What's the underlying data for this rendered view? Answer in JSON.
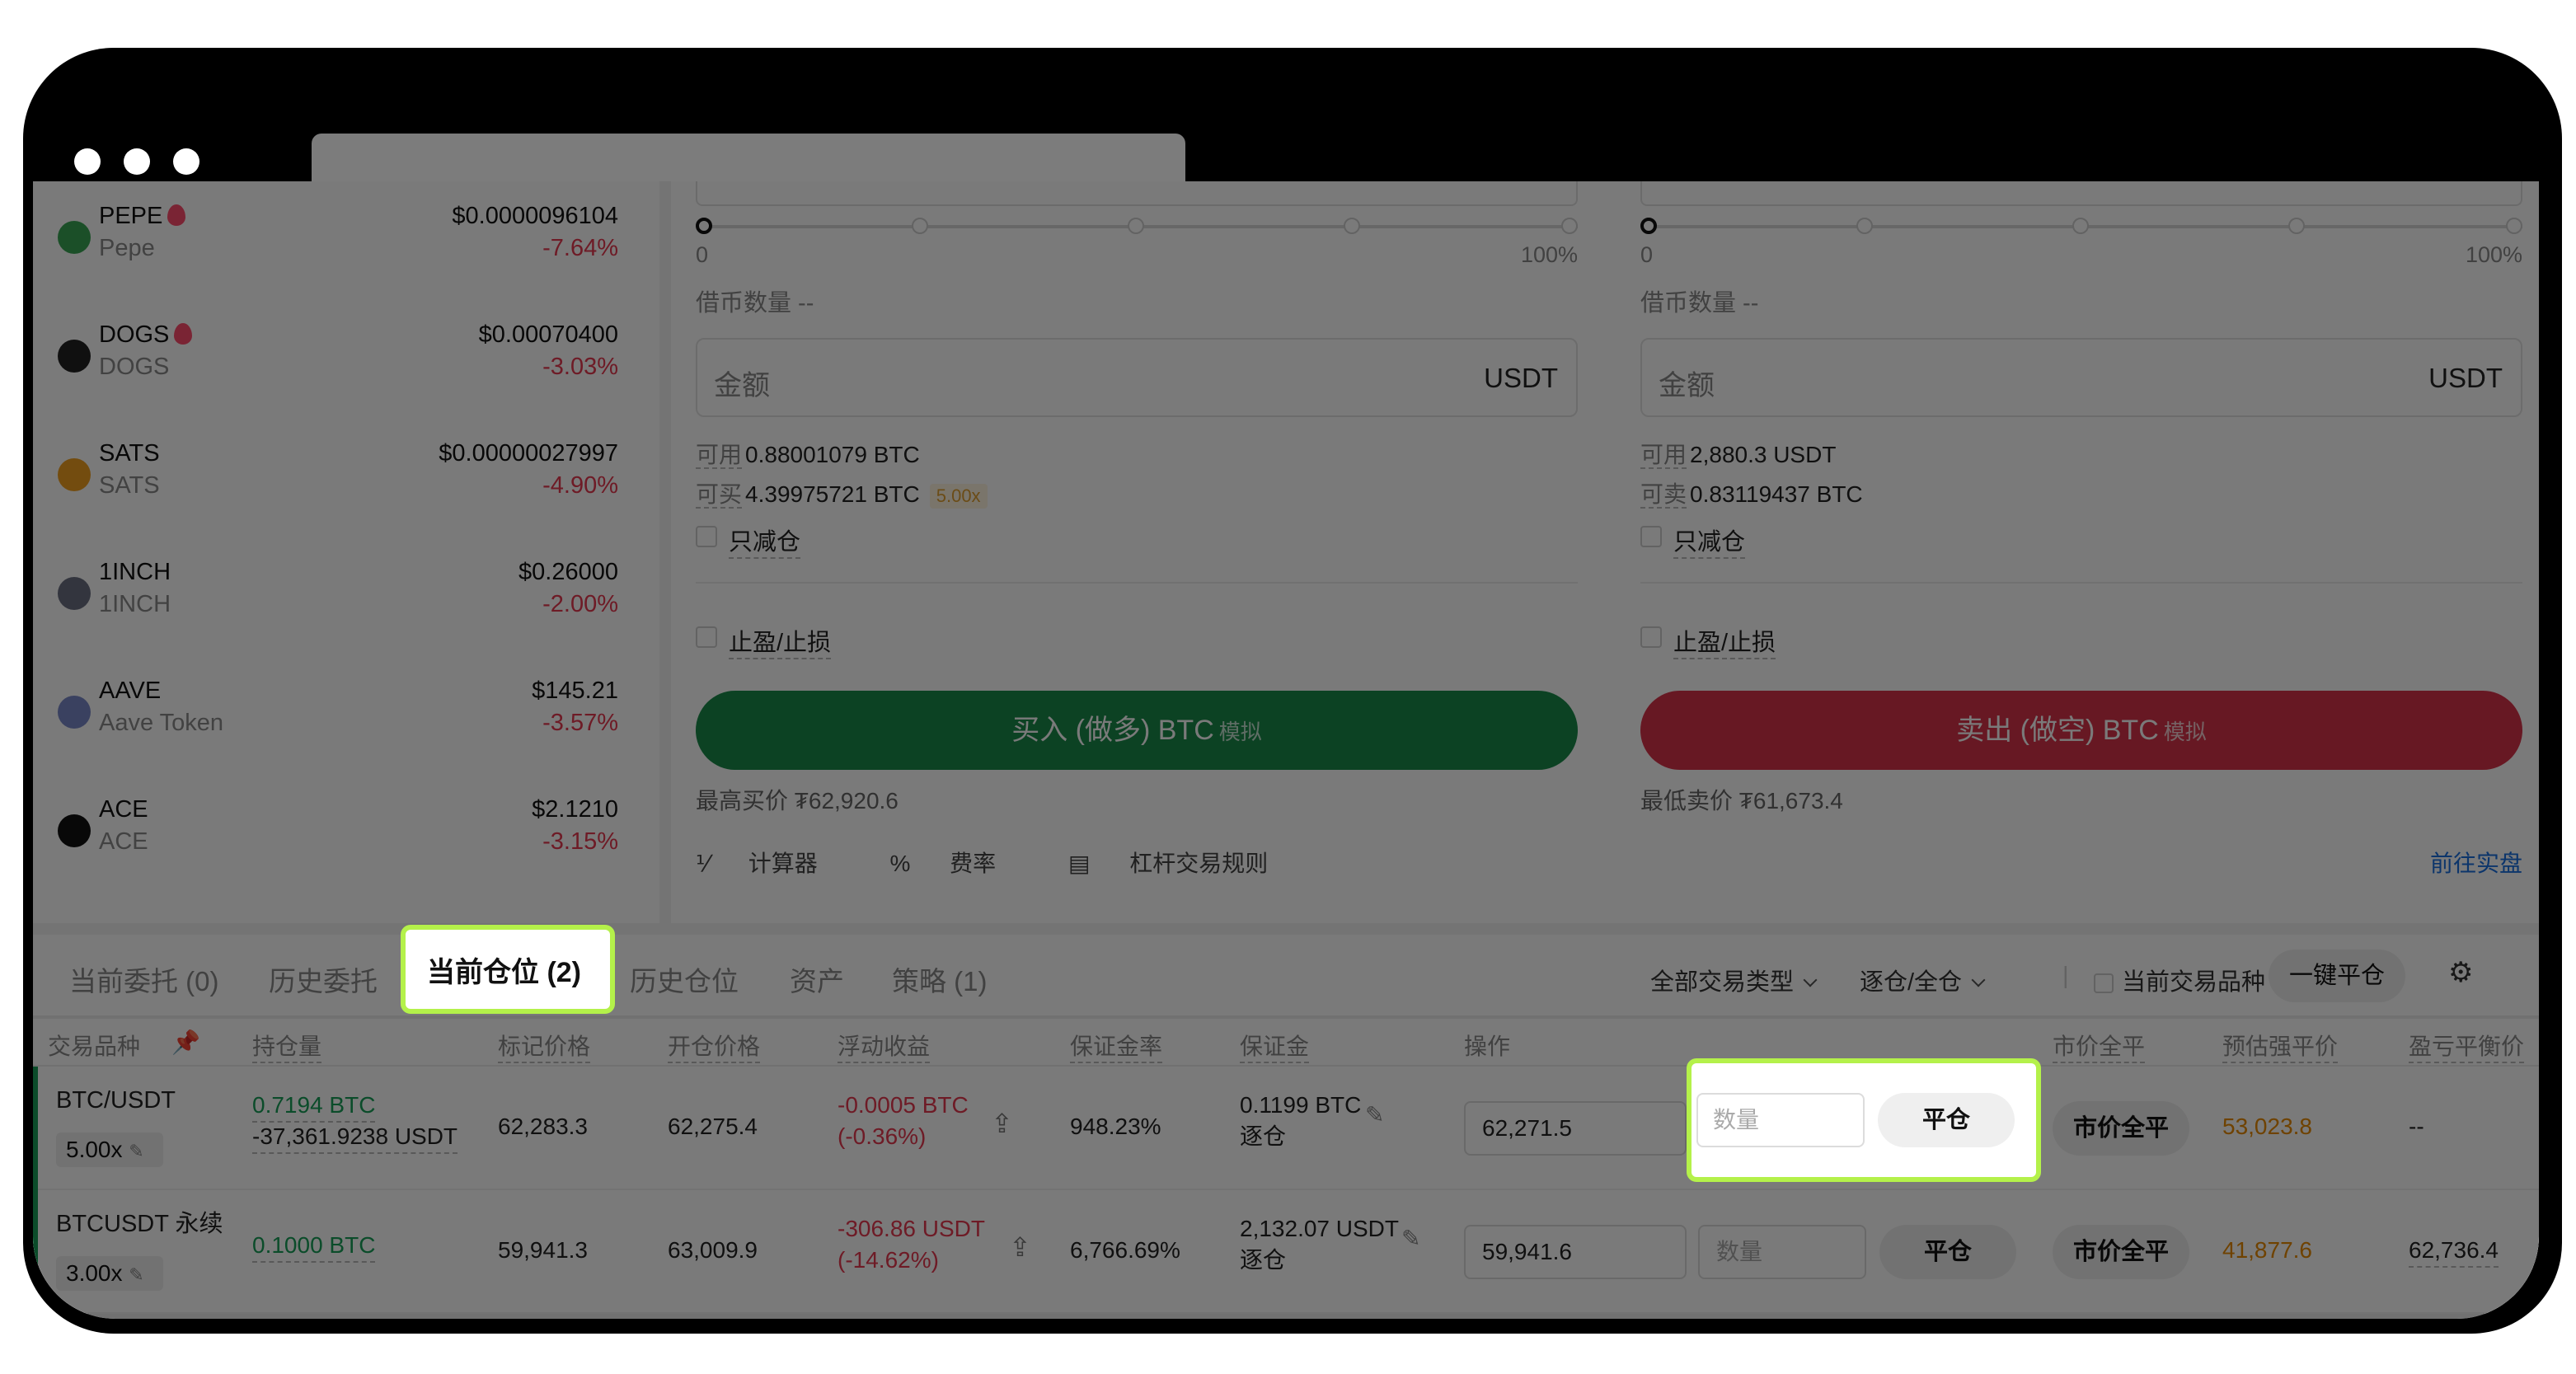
{
  "coins": [
    {
      "symbol": "PEPE",
      "name": "Pepe",
      "price": "$0.0000096104",
      "change": "-7.64%",
      "icon": "pepe-icon",
      "color": "#3aa655",
      "hot": true
    },
    {
      "symbol": "DOGS",
      "name": "DOGS",
      "price": "$0.00070400",
      "change": "-3.03%",
      "icon": "dogs-icon",
      "color": "#222222",
      "hot": true
    },
    {
      "symbol": "SATS",
      "name": "SATS",
      "price": "$0.00000027997",
      "change": "-4.90%",
      "icon": "sats-icon",
      "color": "#f0a020",
      "hot": false
    },
    {
      "symbol": "1INCH",
      "name": "1INCH",
      "price": "$0.26000",
      "change": "-2.00%",
      "icon": "1inch-icon",
      "color": "#6b6f82",
      "hot": false
    },
    {
      "symbol": "AAVE",
      "name": "Aave Token",
      "price": "$145.21",
      "change": "-3.57%",
      "icon": "aave-icon",
      "color": "#7a88c8",
      "hot": false
    },
    {
      "symbol": "ACE",
      "name": "ACE",
      "price": "$2.1210",
      "change": "-3.15%",
      "icon": "ace-icon",
      "color": "#111111",
      "hot": false
    }
  ],
  "buy": {
    "slider_min": "0",
    "slider_max": "100%",
    "borrow": "借币数量 --",
    "amount_placeholder": "金额",
    "amount_unit": "USDT",
    "avail_label": "可用",
    "avail_value": "0.88001079 BTC",
    "canbuy_label": "可买",
    "canbuy_value": "4.39975721 BTC",
    "leverage": "5.00x",
    "reduce_only": "只减仓",
    "tpsl": "止盈/止损",
    "button": "买入 (做多) BTC",
    "sim": "模拟",
    "best": "最高买价 ₮62,920.6",
    "color": "#1a8a4a"
  },
  "sell": {
    "slider_min": "0",
    "slider_max": "100%",
    "borrow": "借币数量 --",
    "amount_placeholder": "金额",
    "amount_unit": "USDT",
    "avail_label": "可用",
    "avail_value": "2,880.3 USDT",
    "cansell_label": "可卖",
    "cansell_value": "0.83119437 BTC",
    "reduce_only": "只减仓",
    "tpsl": "止盈/止损",
    "button": "卖出 (做空) BTC",
    "sim": "模拟",
    "best": "最低卖价 ₮61,673.4",
    "color": "#d8334a"
  },
  "tools": {
    "calculator": "计算器",
    "fee": "费率",
    "rules": "杠杆交易规则",
    "goto_real": "前往实盘"
  },
  "tabs": [
    "当前委托 (0)",
    "历史委托",
    "当前仓位 (2)",
    "历史仓位",
    "资产",
    "策略 (1)"
  ],
  "filters": {
    "type": "全部交易类型",
    "margin": "逐仓/全仓",
    "current_only": "当前交易品种",
    "close_all": "一键平仓"
  },
  "columns": [
    "交易品种",
    "持仓量",
    "标记价格",
    "开仓价格",
    "浮动收益",
    "保证金率",
    "保证金",
    "操作",
    "市价全平",
    "预估强平价",
    "盈亏平衡价"
  ],
  "positions": [
    {
      "pair": "BTC/USDT",
      "leverage": "5.00x",
      "size1": "0.7194 BTC",
      "size2": "-37,361.9238 USDT",
      "mark": "62,283.3",
      "open": "62,275.4",
      "pnl1": "-0.0005 BTC",
      "pnl2": "(-0.36%)",
      "margin_rate": "948.23%",
      "margin": "0.1199 BTC",
      "margin_mode": "逐仓",
      "price_input": "62,271.5",
      "qty_placeholder": "数量",
      "close": "平仓",
      "market_close": "市价全平",
      "liq": "53,023.8",
      "breakeven": "--"
    },
    {
      "pair": "BTCUSDT 永续",
      "leverage": "3.00x",
      "size1": "0.1000 BTC",
      "size2": "",
      "mark": "59,941.3",
      "open": "63,009.9",
      "pnl1": "-306.86 USDT",
      "pnl2": "(-14.62%)",
      "margin_rate": "6,766.69%",
      "margin": "2,132.07 USDT",
      "margin_mode": "逐仓",
      "price_input": "59,941.6",
      "qty_placeholder": "数量",
      "close": "平仓",
      "market_close": "市价全平",
      "liq": "41,877.6",
      "breakeven": "62,736.4"
    }
  ],
  "highlight_color": "#b4f14a"
}
